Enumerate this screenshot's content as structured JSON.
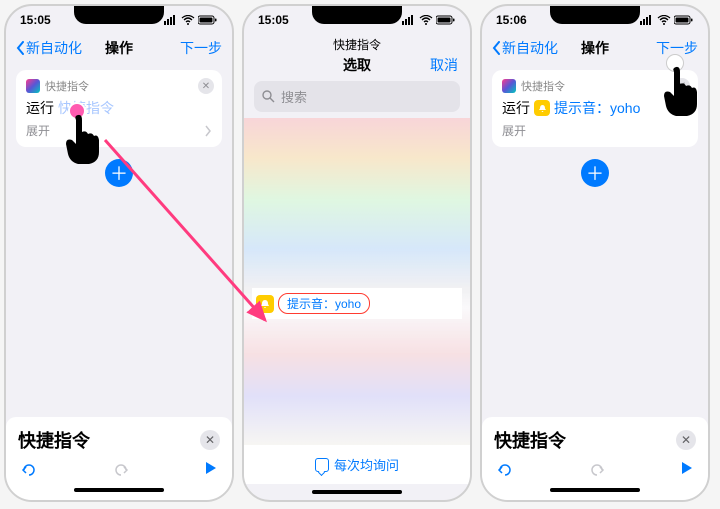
{
  "status": {
    "time1": "15:05",
    "time2": "15:05",
    "time3": "15:06"
  },
  "nav": {
    "back": "新自动化",
    "title": "操作",
    "next": "下一步"
  },
  "card": {
    "app": "快捷指令",
    "run": "运行",
    "placeholder": "快捷指令",
    "expand": "展开"
  },
  "screen2": {
    "title": "快捷指令",
    "subtitle": "选取",
    "cancel": "取消",
    "search_placeholder": "搜索",
    "chip": "提示音：yoho",
    "askEach": "每次均询问"
  },
  "card3": {
    "app": "快捷指令",
    "run": "运行",
    "selected": "提示音：yoho",
    "expand": "展开"
  },
  "dock": {
    "title": "快捷指令"
  }
}
